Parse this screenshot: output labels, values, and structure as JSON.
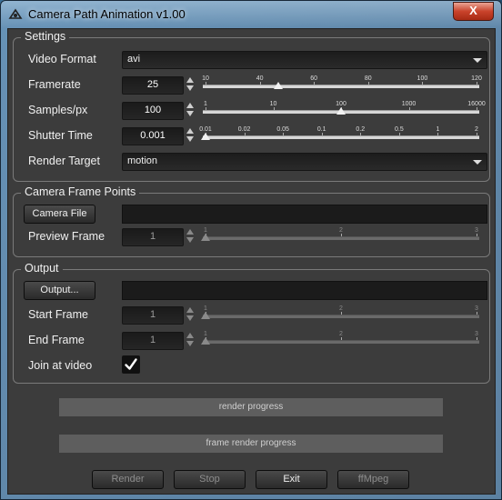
{
  "window": {
    "title": "Camera Path Animation v1.00",
    "close_label": "X"
  },
  "settings": {
    "title": "Settings",
    "video_format": {
      "label": "Video Format",
      "value": "avi"
    },
    "framerate": {
      "label": "Framerate",
      "value": "25",
      "ticks": [
        "10",
        "40",
        "60",
        "80",
        "100",
        "120"
      ],
      "position": 0.27
    },
    "samples": {
      "label": "Samples/px",
      "value": "100",
      "ticks": [
        "1",
        "10",
        "100",
        "1000",
        "16000"
      ],
      "position": 0.5
    },
    "shutter": {
      "label": "Shutter Time",
      "value": "0.001",
      "ticks": [
        "0.01",
        "0.02",
        "0.05",
        "0.1",
        "0.2",
        "0.5",
        "1",
        "2"
      ],
      "position": 0.0
    },
    "render_target": {
      "label": "Render Target",
      "value": "motion"
    }
  },
  "camera": {
    "title": "Camera Frame Points",
    "file_button": "Camera File",
    "file_path": "",
    "preview": {
      "label": "Preview Frame",
      "value": "1",
      "ticks": [
        "1",
        "2",
        "3"
      ],
      "position": 0.0
    }
  },
  "output": {
    "title": "Output",
    "button": "Output...",
    "path": "",
    "start": {
      "label": "Start Frame",
      "value": "1",
      "ticks": [
        "1",
        "2",
        "3"
      ],
      "position": 0.0
    },
    "end": {
      "label": "End Frame",
      "value": "1",
      "ticks": [
        "1",
        "2",
        "3"
      ],
      "position": 0.0
    },
    "join": {
      "label": "Join at video",
      "checked": true
    }
  },
  "progress": {
    "render": "render progress",
    "frame": "frame render progress"
  },
  "buttons": {
    "render": "Render",
    "stop": "Stop",
    "exit": "Exit",
    "ffmpeg": "ffMpeg"
  }
}
